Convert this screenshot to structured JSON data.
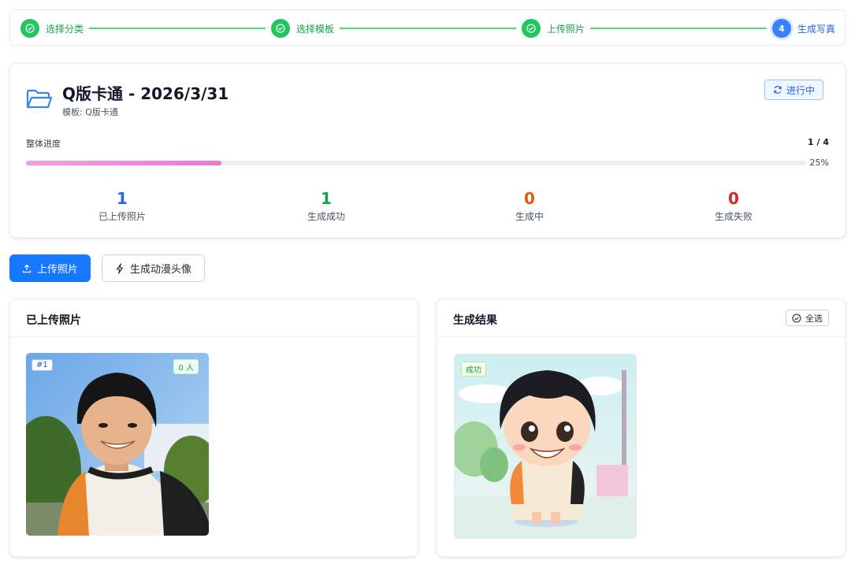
{
  "stepper": {
    "steps": [
      {
        "label": "选择分类",
        "status": "done"
      },
      {
        "label": "选择模板",
        "status": "done"
      },
      {
        "label": "上传照片",
        "status": "done"
      },
      {
        "label": "生成写真",
        "status": "active",
        "number": "4"
      }
    ]
  },
  "task": {
    "title": "Q版卡通 - 2026/3/31",
    "template_line": "模板: Q版卡通",
    "status_label": "进行中"
  },
  "progress": {
    "label": "整体进度",
    "count_text": "1 / 4",
    "percent_text": "25%",
    "fraction": 0.25
  },
  "stats": [
    {
      "value": "1",
      "label": "已上传照片",
      "color": "#2563eb"
    },
    {
      "value": "1",
      "label": "生成成功",
      "color": "#16a34a"
    },
    {
      "value": "0",
      "label": "生成中",
      "color": "#ea580c"
    },
    {
      "value": "0",
      "label": "生成失败",
      "color": "#dc2626"
    }
  ],
  "actions": {
    "upload_label": "上传照片",
    "generate_label": "生成动漫头像"
  },
  "uploaded_panel": {
    "title": "已上传照片",
    "photo": {
      "index_tag": "#1",
      "people_tag": "0 人"
    }
  },
  "results_panel": {
    "title": "生成结果",
    "select_all_label": "全选",
    "result": {
      "status_tag": "成功"
    }
  },
  "colors": {
    "primary": "#1677ff",
    "success": "#22c55e",
    "progress": "#e87ad6"
  }
}
